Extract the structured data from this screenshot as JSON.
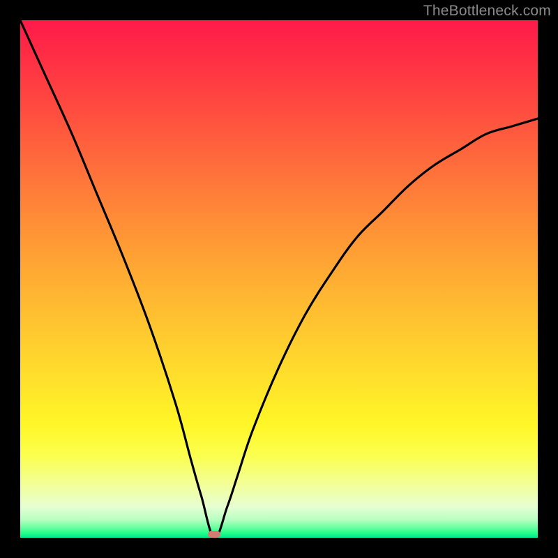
{
  "watermark": "TheBottleneck.com",
  "marker": {
    "x_pct": 37.5,
    "y_pct": 99.3
  },
  "colors": {
    "frame": "#000000",
    "curve": "#000000",
    "marker": "#d87a74",
    "watermark": "#8a8a8a"
  },
  "chart_data": {
    "type": "line",
    "title": "",
    "xlabel": "",
    "ylabel": "",
    "xlim": [
      0,
      100
    ],
    "ylim": [
      0,
      100
    ],
    "annotations": [
      "TheBottleneck.com"
    ],
    "series": [
      {
        "name": "bottleneck-curve",
        "x": [
          0,
          5,
          10,
          15,
          20,
          25,
          30,
          33,
          35,
          37.5,
          40,
          42,
          45,
          50,
          55,
          60,
          65,
          70,
          75,
          80,
          85,
          90,
          95,
          100
        ],
        "y": [
          100,
          89,
          78,
          66,
          54,
          41,
          26,
          15,
          8,
          0,
          6,
          12,
          21,
          33,
          43,
          51,
          58,
          63,
          68,
          72,
          75,
          78,
          79.5,
          81
        ]
      }
    ],
    "gradient_stops": [
      {
        "pos": 0.0,
        "color": "#ff1a4a"
      },
      {
        "pos": 0.5,
        "color": "#ffab33"
      },
      {
        "pos": 0.8,
        "color": "#fff627"
      },
      {
        "pos": 0.96,
        "color": "#b7ffc2"
      },
      {
        "pos": 1.0,
        "color": "#00e58e"
      }
    ],
    "optimum_x": 37.5
  }
}
